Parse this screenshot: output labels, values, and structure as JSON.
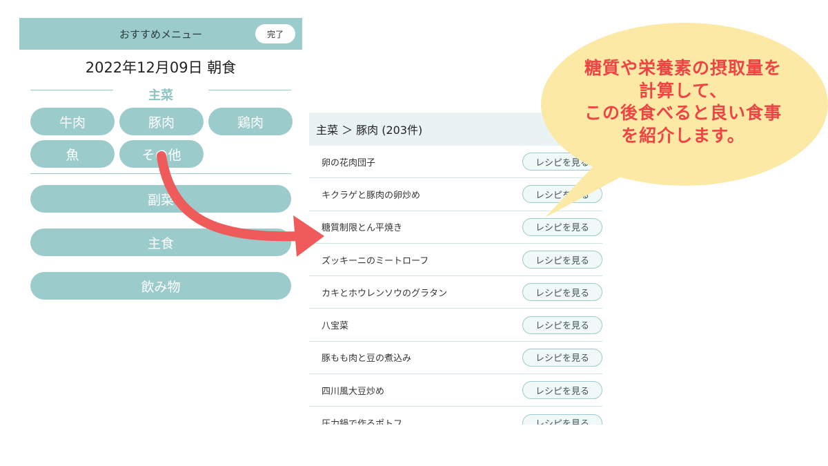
{
  "header": {
    "title": "おすすめメニュー",
    "done_label": "完了"
  },
  "date_line": "2022年12月09日 朝食",
  "section": {
    "label": "主菜"
  },
  "chips": [
    {
      "label": "牛肉"
    },
    {
      "label": "豚肉"
    },
    {
      "label": "鶏肉"
    },
    {
      "label": "魚"
    },
    {
      "label": "その他"
    }
  ],
  "categories": [
    {
      "label": "副菜"
    },
    {
      "label": "主食"
    },
    {
      "label": "飲み物"
    }
  ],
  "list": {
    "breadcrumb": "主菜 ＞ 豚肉 (203件)",
    "button_label": "レシピを見る",
    "items": [
      {
        "name": "卵の花肉団子"
      },
      {
        "name": "キクラゲと豚肉の卵炒め"
      },
      {
        "name": "糖質制限とん平焼き"
      },
      {
        "name": "ズッキーニのミートローフ"
      },
      {
        "name": "カキとホウレンソウのグラタン"
      },
      {
        "name": "八宝菜"
      },
      {
        "name": "豚もも肉と豆の煮込み"
      },
      {
        "name": "四川風大豆炒め"
      },
      {
        "name": "圧力鍋で作るポトフ"
      }
    ]
  },
  "callout": {
    "lines": [
      "糖質や栄養素の摂取量を",
      "計算して、",
      "この後食べると良い食事",
      "を紹介します。"
    ]
  },
  "colors": {
    "accent": "#9ccbcb",
    "arrow": "#ef5a5a",
    "bubble": "#fbe9a5",
    "callout_text": "#ef4444"
  },
  "icons": {
    "arrow": "curved-arrow-icon"
  }
}
